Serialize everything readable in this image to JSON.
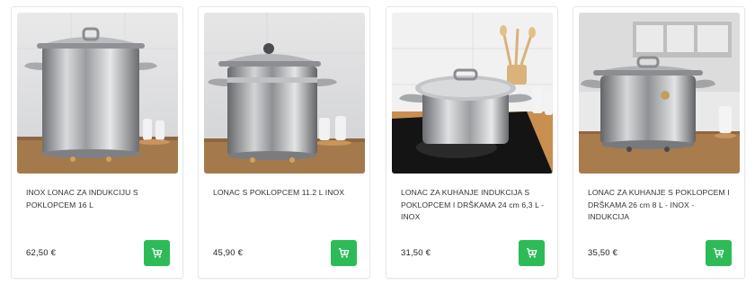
{
  "products": [
    {
      "title": "INOX LONAC ZA INDUKCIJU S POKLOPCEM 16 L",
      "price": "62,50 €",
      "image": "stockpot-16l-photo"
    },
    {
      "title": "LONAC S POKLOPCEM 11.2 L INOX",
      "price": "45,90 €",
      "image": "stockpot-11l-photo"
    },
    {
      "title": "LONAC ZA KUHANJE INDUKCIJA S POKLOPCEM I DRŠKAMA 24 cm 6,3 L - INOX",
      "price": "31,50 €",
      "image": "pot-24cm-induction-photo"
    },
    {
      "title": "LONAC ZA KUHANJE S POKLOPCEM I DRŠKAMA 26 cm 8 L - INOX - INDUKCIJA",
      "price": "35,50 €",
      "image": "pot-26cm-photo"
    }
  ],
  "icons": {
    "cart": "cart-plus-icon"
  },
  "colors": {
    "cart_button": "#2dbb58",
    "card_border": "#e7e7e7",
    "text": "#333333"
  }
}
